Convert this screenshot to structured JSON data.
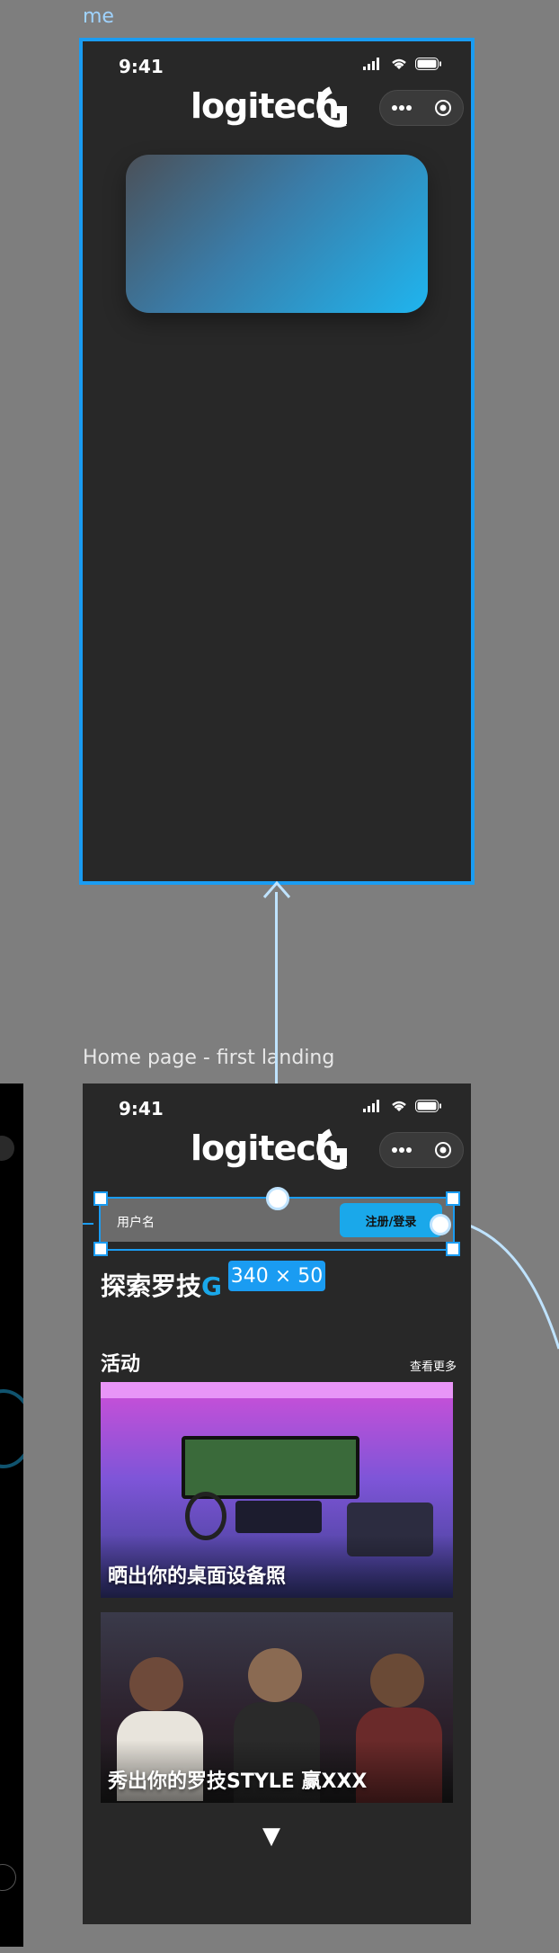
{
  "canvas": {
    "frame_me_label": "me",
    "frame_home_label": "Home page - first landing"
  },
  "status_bar": {
    "time": "9:41"
  },
  "brand": {
    "logo_text": "logitech"
  },
  "home": {
    "search_placeholder": "用户名",
    "login_button": "注册/登录",
    "selection_size": "340 × 50",
    "explore_title": "探索罗技",
    "explore_title_accent": "G",
    "section_title": "活动",
    "see_more": "查看更多",
    "promos": [
      {
        "caption": "晒出你的桌面设备照"
      },
      {
        "caption": "秀出你的罗技STYLE 赢XXX"
      }
    ],
    "scroll_indicator": "▼"
  },
  "colors": {
    "accent": "#1a9cf2",
    "phone_bg": "#282828",
    "canvas_bg": "#7e7e7e",
    "button": "#1aa8ea"
  }
}
